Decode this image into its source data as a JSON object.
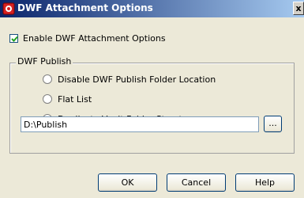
{
  "window": {
    "title": "DWF Attachment Options",
    "close_glyph": "x"
  },
  "options": {
    "enable_label": "Enable DWF Attachment Options",
    "enable_checked": true
  },
  "dwf_publish": {
    "legend": "DWF Publish",
    "radios": [
      {
        "label": "Disable DWF Publish Folder Location",
        "selected": false
      },
      {
        "label": "Flat List",
        "selected": false
      },
      {
        "label": "Duplicate Vault Folder Structure",
        "selected": true
      }
    ],
    "path_value": "D:\\Publish",
    "browse_label": "..."
  },
  "buttons": {
    "ok": "OK",
    "cancel": "Cancel",
    "help": "Help"
  },
  "colors": {
    "title_bar": "#0a246a",
    "dialog_bg": "#ece9d8",
    "icon_red": "#d62020"
  }
}
